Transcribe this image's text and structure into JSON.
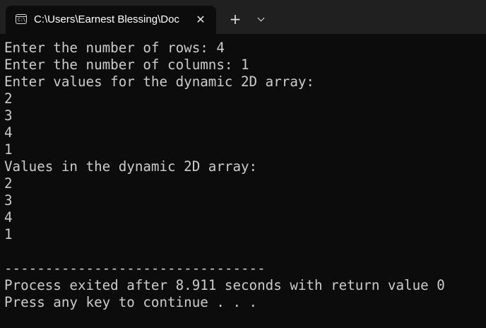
{
  "tab": {
    "title": "C:\\Users\\Earnest Blessing\\Doc",
    "icon": "terminal-icon",
    "close_glyph": "✕"
  },
  "toolbar": {
    "new_tab_glyph": "+",
    "dropdown_icon": "chevron-down-icon"
  },
  "console": {
    "lines": [
      "Enter the number of rows: 4",
      "Enter the number of columns: 1",
      "Enter values for the dynamic 2D array:",
      "2",
      "3",
      "4",
      "1",
      "Values in the dynamic 2D array:",
      "2",
      "3",
      "4",
      "1",
      "",
      "--------------------------------",
      "Process exited after 8.911 seconds with return value 0",
      "Press any key to continue . . ."
    ]
  },
  "colors": {
    "background": "#0c0c0c",
    "tabbar": "#202020",
    "text": "#cccccc"
  }
}
